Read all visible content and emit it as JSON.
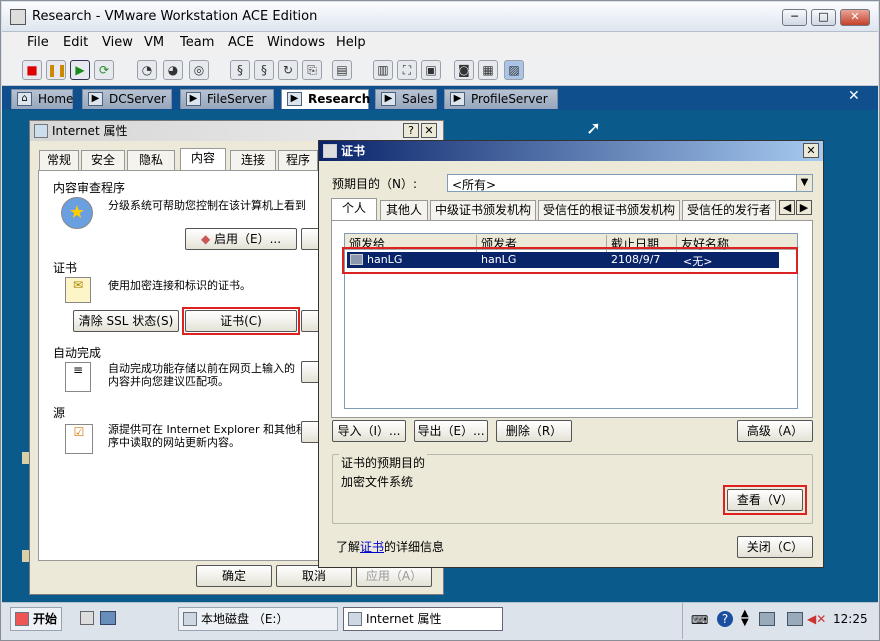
{
  "window": {
    "title": "Research - VMware Workstation ACE Edition",
    "min": "─",
    "max": "□",
    "close": "✕"
  },
  "menu": [
    "File",
    "Edit",
    "View",
    "VM",
    "Team",
    "ACE",
    "Windows",
    "Help"
  ],
  "vm_tabs": [
    {
      "label": "Home"
    },
    {
      "label": "DCServer"
    },
    {
      "label": "FileServer"
    },
    {
      "label": "Research"
    },
    {
      "label": "Sales"
    },
    {
      "label": "ProfileServer"
    }
  ],
  "tabs_close": "✕",
  "inet": {
    "title": "Internet 属性",
    "help": "?",
    "close": "✕",
    "tabs": [
      "常规",
      "安全",
      "隐私",
      "内容",
      "连接",
      "程序"
    ],
    "content_advisor": {
      "legend": "内容审查程序",
      "text": "分级系统可帮助您控制在该计算机上看到",
      "enable_button": "启用（E）..."
    },
    "certs": {
      "legend": "证书",
      "text": "使用加密连接和标识的证书。",
      "clear_ssl_button": "清除 SSL 状态(S)",
      "certs_button": "证书(C)"
    },
    "autocomplete": {
      "legend": "自动完成",
      "text": "自动完成功能存储以前在网页上输入的内容并向您建议匹配项。"
    },
    "feeds": {
      "legend": "源",
      "text": "源提供可在 Internet Explorer 和其他程序中读取的网站更新内容。"
    },
    "ok": "确定",
    "cancel": "取消",
    "apply": "应用（A）"
  },
  "cert": {
    "title": "证书",
    "close": "✕",
    "purpose_label": "预期目的（N）:",
    "purpose_value": "<所有>",
    "tabs": [
      "个人",
      "其他人",
      "中级证书颁发机构",
      "受信任的根证书颁发机构",
      "受信任的发行者"
    ],
    "columns": [
      "颁发给",
      "颁发者",
      "截止日期",
      "友好名称"
    ],
    "rows": [
      {
        "issued_to": "hanLG",
        "issued_by": "hanLG",
        "expires": "2108/9/7",
        "friendly": "<无>"
      }
    ],
    "import": "导入（I）...",
    "export": "导出（E）...",
    "remove": "删除（R）",
    "advanced": "高级（A）",
    "purposes_legend": "证书的预期目的",
    "purposes_value": "加密文件系统",
    "view": "查看（V）",
    "learn_prefix": "了解",
    "learn_link": "证书",
    "learn_suffix": "的详细信息",
    "close_button": "关闭（C）"
  },
  "taskbar": {
    "start": "开始",
    "items": [
      {
        "label": "本地磁盘 （E:）"
      },
      {
        "label": "Internet 属性"
      }
    ],
    "clock": "12:25"
  }
}
